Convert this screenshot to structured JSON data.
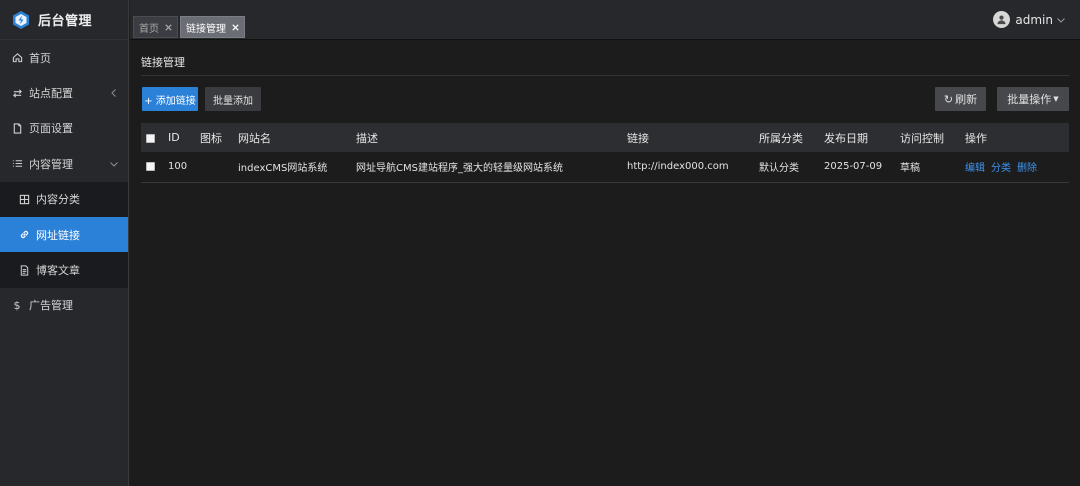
{
  "app": {
    "title": "后台管理",
    "brand_color": "#2b81d8"
  },
  "sidebar": {
    "items": [
      {
        "label": "首页",
        "icon": "home-icon"
      },
      {
        "label": "站点配置",
        "icon": "swap-icon"
      },
      {
        "label": "页面设置",
        "icon": "file-icon"
      },
      {
        "label": "内容管理",
        "icon": "list-icon"
      }
    ],
    "sub_items": [
      {
        "label": "内容分类",
        "icon": "grid-icon"
      },
      {
        "label": "网址链接",
        "icon": "link-icon"
      },
      {
        "label": "博客文章",
        "icon": "document-icon"
      }
    ],
    "ads": {
      "label": "广告管理",
      "icon": "dollar-icon"
    }
  },
  "tabs": [
    {
      "label": "首页",
      "active": false
    },
    {
      "label": "链接管理",
      "active": true
    }
  ],
  "user": {
    "name": "admin"
  },
  "main": {
    "title": "链接管理",
    "buttons": {
      "add": "+ 添加链接",
      "batch_add": "批量添加",
      "refresh": "刷新",
      "batch_ops": "批量操作"
    }
  },
  "table": {
    "headers": [
      "ID",
      "图标",
      "网站名",
      "描述",
      "链接",
      "所属分类",
      "发布日期",
      "访问控制",
      "操作"
    ],
    "rows": [
      {
        "id": "100",
        "icon": "",
        "name": "indexCMS网站系统",
        "desc": "网址导航CMS建站程序_强大的轻量级网站系统",
        "url": "http://index000.com",
        "category": "默认分类",
        "date": "2025-07-09",
        "access": "草稿",
        "actions": [
          "编辑",
          "分类",
          "删除"
        ]
      }
    ]
  }
}
